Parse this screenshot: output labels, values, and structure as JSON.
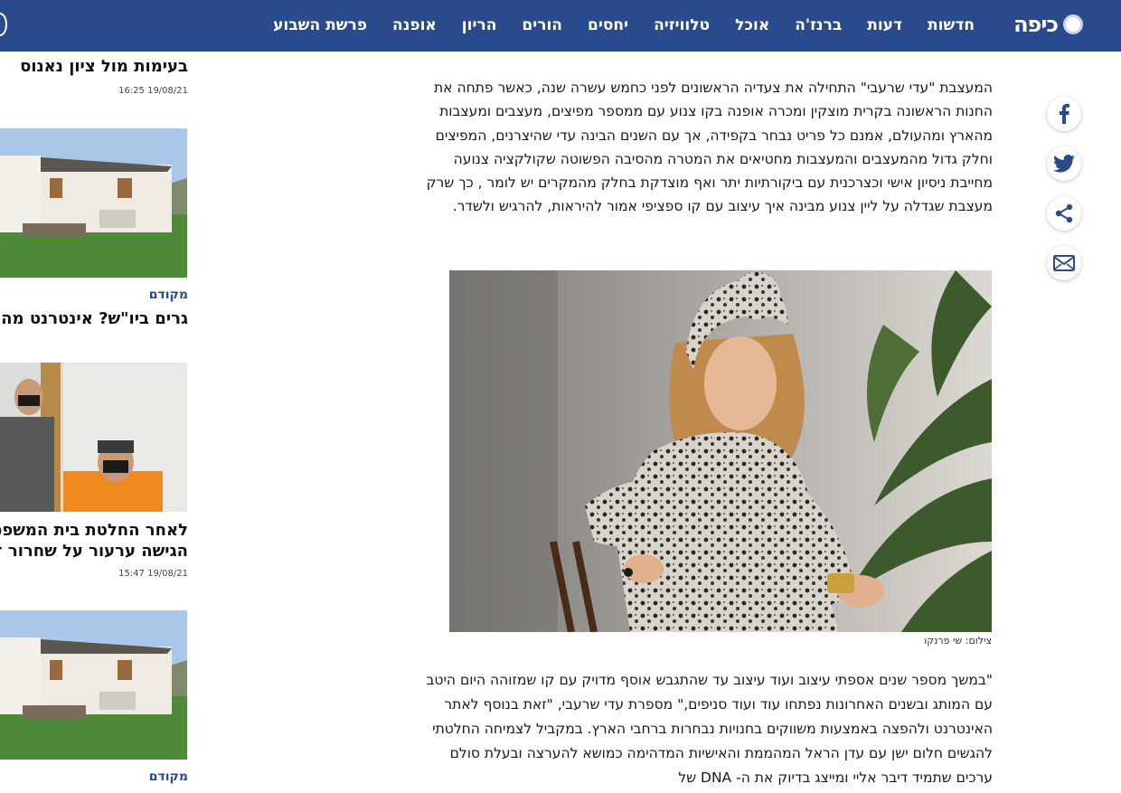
{
  "header": {
    "logo_text": "כיפה",
    "nav": [
      "חדשות",
      "דעות",
      "ברנז'ה",
      "אוכל",
      "טלוויזיה",
      "יחסים",
      "הורים",
      "הריון",
      "אופנה",
      "פרשת השבוע"
    ]
  },
  "share": {
    "icons": [
      "facebook-icon",
      "twitter-icon",
      "share-icon",
      "email-icon"
    ]
  },
  "article": {
    "paragraph1": "המעצבת \"עדי שרעבי\" התחילה את צעדיה הראשונים לפני כחמש עשרה שנה, כאשר פתחה את החנות הראשונה בקרית מוצקין ומכרה אופנה בקו צנוע עם ממספר מפיצים, מעצבים ומעצבות מהארץ ומהעולם, אמנם כל פריט נבחר בקפידה, אך עם השנים הבינה עדי שהיצרנים, המפיצים  וחלק גדול מהמעצבים והמעצבות מחטיאים את המטרה מהסיבה הפשוטה שקולקציה צנועה מחייבת ניסיון אישי וכצרכנית עם ביקורתיות יתר ואף מוצדקת בחלק מהמקרים יש לומר , כך שרק מעצבת שגדלה על ליין צנוע מבינה איך עיצוב עם קו ספציפי אמור להיראות, להרגיש ולשדר.",
    "photo_credit": "צילום: שי פרנקו",
    "paragraph2": "\"במשך מספר שנים אספתי עיצוב ועוד עיצוב עד שהתגבש אוסף מדויק עם קו שמזוהה היום היטב עם המותג ובשנים האחרונות נפתחו עוד ועוד סניפים,\" מספרת עדי שרעבי, \"זאת בנוסף לאתר האינטרנט ולהפצה באמצעות משווקים בחנויות נבחרות ברחבי הארץ. במקביל לצמיחה החלטתי להגשים חלום ישן עם עדן הראל המהממת והאישיות המדהימה כמושא להערצה ובעלת סולם ערכים שתמיד דיבר אליי ומייצג בדיוק את ה- DNA של"
  },
  "sidebar": {
    "items": [
      {
        "headline": "בעימות מול ציון נאנוס",
        "date": "16:25 19/08/21"
      },
      {
        "promoted": "מקודם",
        "headline": "גרים ביו\"ש? אינטרנט מהיר ב"
      },
      {
        "headline_line1": "לאחר החלטת בית המשפט, ה",
        "headline_line2": "הגישה ערעור על שחרור זדו",
        "date": "15:47 19/08/21"
      },
      {
        "promoted": "מקודם"
      }
    ]
  },
  "colors": {
    "nav_bg": "#2a4a8e",
    "promoted": "#2a4a8e"
  }
}
